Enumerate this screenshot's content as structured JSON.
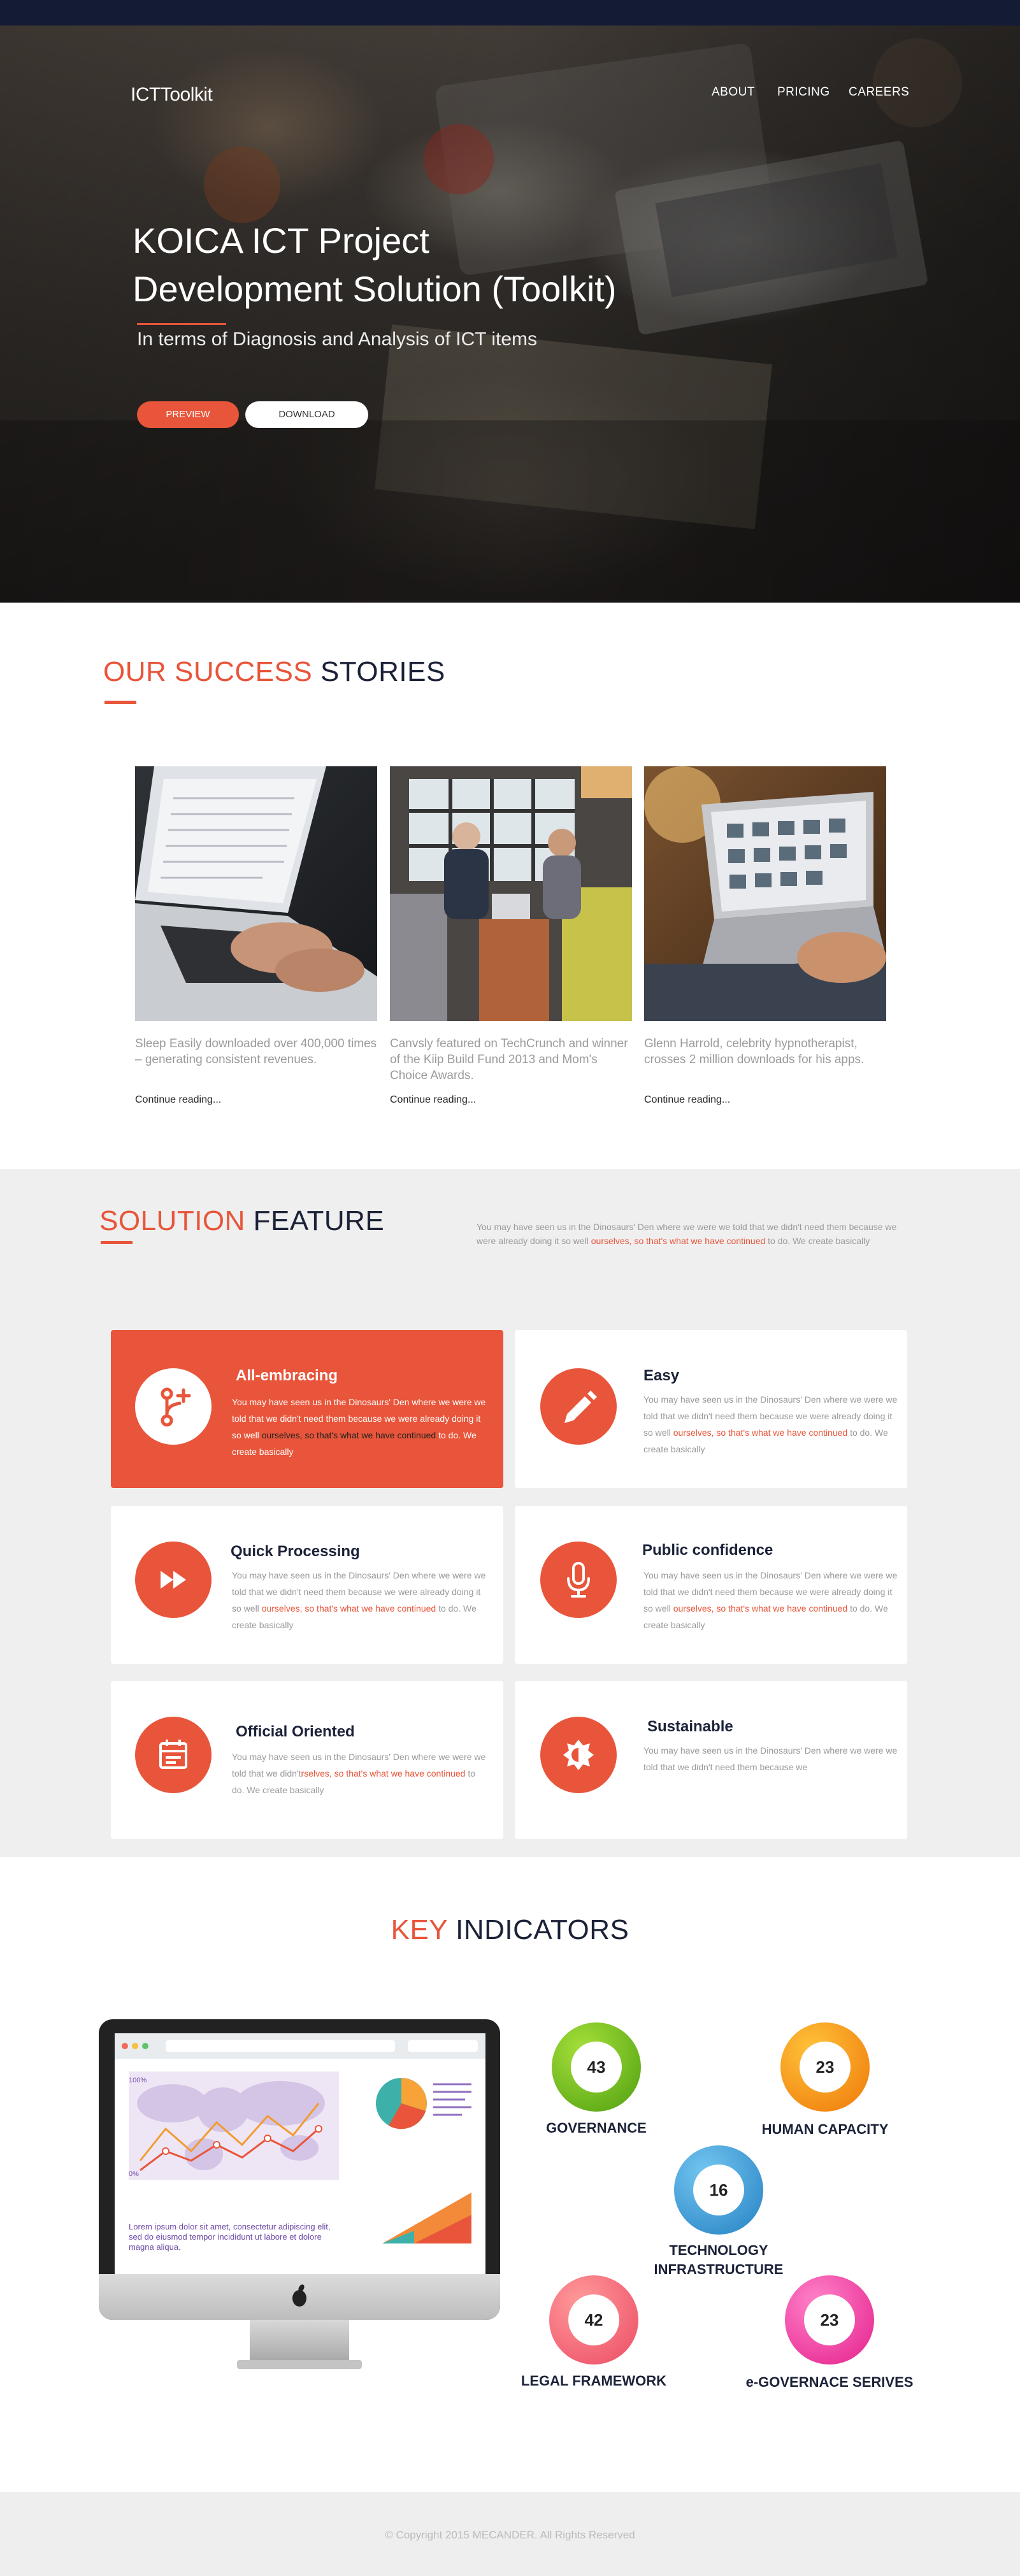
{
  "header": {
    "logo": "ICTToolkit",
    "nav": [
      {
        "label": "ABOUT"
      },
      {
        "label": "PRICING"
      },
      {
        "label": "CAREERS"
      }
    ]
  },
  "hero": {
    "title_line1": "KOICA ICT Project",
    "title_line2": "Development Solution (Toolkit)",
    "subtitle": "In terms of Diagnosis and Analysis of ICT items",
    "preview_label": "PREVIEW",
    "download_label": "DOWNLOAD"
  },
  "stories": {
    "title_accent": "OUR SUCCESS",
    "title_rest": "STORIES",
    "items": [
      {
        "text": "Sleep Easily downloaded over 400,000 times – generating consistent revenues.",
        "link": "Continue reading..."
      },
      {
        "text": "Canvsly featured on TechCrunch and winner of the Kiip Build Fund 2013 and Mom's Choice Awards.",
        "link": "Continue reading..."
      },
      {
        "text": "Glenn Harrold, celebrity hypnotherapist, crosses 2 million downloads for his apps.",
        "link": "Continue reading..."
      }
    ]
  },
  "features": {
    "title_accent": "SOLUTION",
    "title_rest": "FEATURE",
    "desc_plain": "You may have seen us in the Dinosaurs' Den where we were we told that we didn't need them because we were already doing it so well ",
    "desc_highlight": "ourselves, so that's what we have continued",
    "desc_end": " to do. We create basically",
    "cards": [
      {
        "title": "All-embracing",
        "icon": "branch-plus-icon",
        "body_a": "You may have seen us in the Dinosaurs' Den where we were we told that we didn't need them because we were already doing it so well ",
        "body_hl": "ourselves, so that's what we have continued",
        "body_end": " to do. We create basically"
      },
      {
        "title": "Easy",
        "icon": "pencil-icon",
        "body_a": "You may have seen us in the Dinosaurs' Den where we were we told that we didn't need them because we were already doing it so well ",
        "body_hl": "ourselves, so that's what we have continued",
        "body_end": " to do. We create basically"
      },
      {
        "title": "Quick Processing",
        "icon": "fast-forward-icon",
        "body_a": "You may have seen us in the Dinosaurs' Den where we were we told that we didn't need them because we were already doing it so well ",
        "body_hl": "ourselves, so that's what we have continued",
        "body_end": " to do. We create basically"
      },
      {
        "title": "Public confidence",
        "icon": "microphone-icon",
        "body_a": "You may have seen us in the Dinosaurs' Den where we were we told that we didn't need them because we were already doing it so well ",
        "body_hl": "ourselves, so that's what we have continued",
        "body_end": " to do. We create basically"
      },
      {
        "title": "Official Oriented",
        "icon": "calendar-icon",
        "body_a": "You may have seen us in the Dinosaurs' Den where we were we told that we didn't",
        "body_hl": "rselves, so that's what we have continued",
        "body_end": " to do. We create basically"
      },
      {
        "title": "Sustainable",
        "icon": "brightness-icon",
        "body_a": "You may have seen us in the Dinosaurs' Den where we were we told that we didn't need them because we",
        "body_hl": "",
        "body_end": ""
      }
    ]
  },
  "indicators": {
    "title_accent": "KEY",
    "title_rest": "INDICATORS",
    "screen_caption": "Lorem ipsum dolor sit amet, consectetur adipiscing elit, sed do eiusmod tempor incididunt ut labore et dolore magna aliqua.",
    "screen_axis_top": "100%",
    "screen_axis_bottom": "0%",
    "items": [
      {
        "value": "43",
        "label": "GOVERNANCE",
        "color_a": "#8fd21d",
        "color_b": "#56a80e"
      },
      {
        "value": "23",
        "label": "HUMAN CAPACITY",
        "color_a": "#ffb21e",
        "color_b": "#f07d09"
      },
      {
        "value": "16",
        "label_line1": "TECHNOLOGY",
        "label_line2": "INFRASTRUCTURE",
        "color_a": "#5fb8ea",
        "color_b": "#2a87c8"
      },
      {
        "value": "42",
        "label": "LEGAL FRAMEWORK",
        "color_a": "#ff8a8a",
        "color_b": "#f0506a"
      },
      {
        "value": "23",
        "label": "e-GOVERNACE SERIVES",
        "color_a": "#ff6fc0",
        "color_b": "#e8248f"
      }
    ]
  },
  "footer": {
    "copyright": "© Copyright 2015 MECANDER. All Rights Reserved"
  },
  "colors": {
    "accent": "#e8553a",
    "navy": "#1b2238"
  }
}
